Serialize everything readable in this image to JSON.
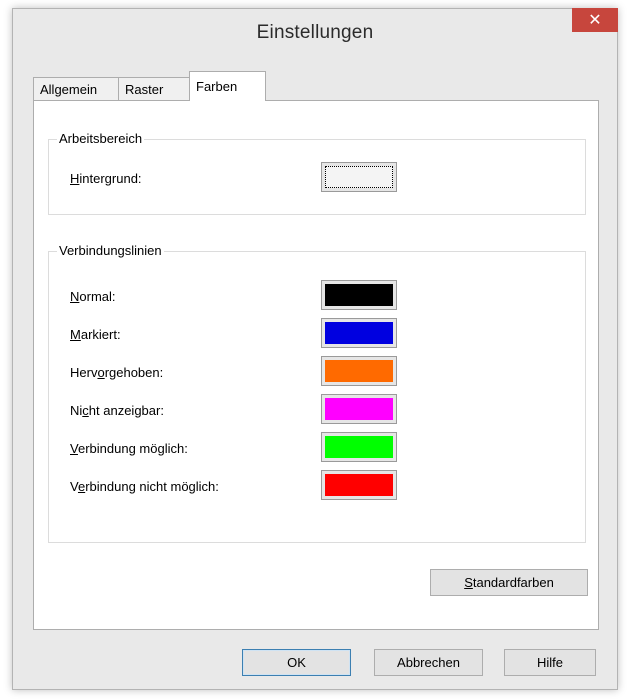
{
  "window": {
    "title": "Einstellungen",
    "close_glyph": "✕"
  },
  "tabs": [
    {
      "label": "Allgemein",
      "active": false
    },
    {
      "label": "Raster",
      "active": false
    },
    {
      "label": "Farben",
      "active": true
    }
  ],
  "workspace_group": {
    "label": "Arbeitsbereich",
    "background": {
      "mnemonic": "H",
      "rest": "intergrund:",
      "color": "#f4f4f4"
    }
  },
  "lines_group": {
    "label": "Verbindungslinien",
    "rows": [
      {
        "pre": "",
        "mnemonic": "N",
        "rest": "ormal:",
        "color": "#000000"
      },
      {
        "pre": "",
        "mnemonic": "M",
        "rest": "arkiert:",
        "color": "#0000e0"
      },
      {
        "pre": "Herv",
        "mnemonic": "o",
        "rest": "rgehoben:",
        "color": "#ff6a00"
      },
      {
        "pre": "Ni",
        "mnemonic": "c",
        "rest": "ht anzeigbar:",
        "color": "#ff00ff"
      },
      {
        "pre": "",
        "mnemonic": "V",
        "rest": "erbindung möglich:",
        "color": "#00ff00"
      },
      {
        "pre": "V",
        "mnemonic": "e",
        "rest": "rbindung nicht möglich:",
        "color": "#ff0000"
      }
    ]
  },
  "standard_button": {
    "mnemonic": "S",
    "rest": "tandardfarben"
  },
  "footer": {
    "ok": "OK",
    "cancel": "Abbrechen",
    "help": "Hilfe"
  }
}
